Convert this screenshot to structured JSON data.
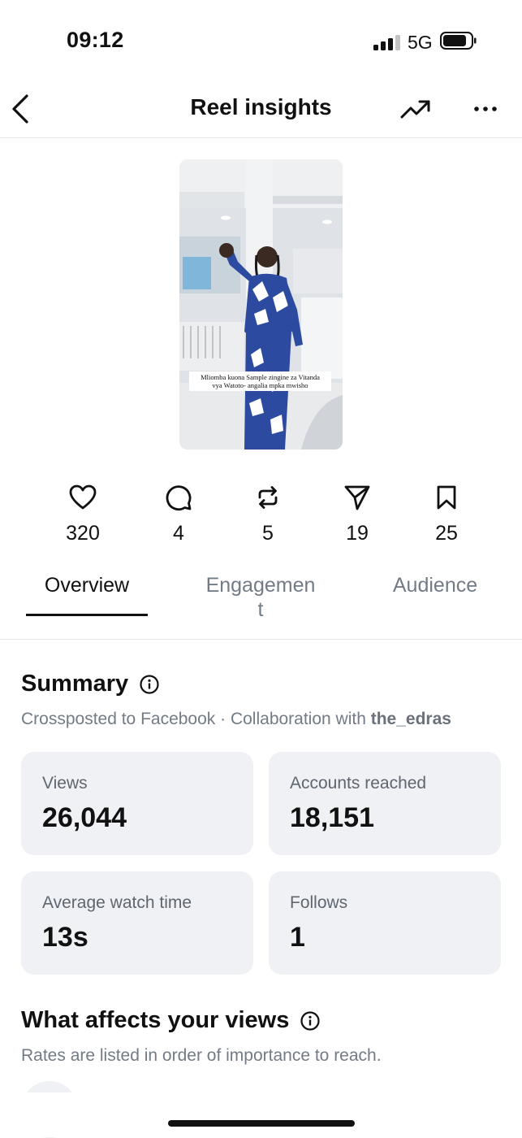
{
  "status_bar": {
    "time": "09:12",
    "network": "5G",
    "signal_bars": 3,
    "battery_level": 0.85
  },
  "header": {
    "title": "Reel insights",
    "back_icon": "chevron-left-icon",
    "trend_icon": "trending-up-icon",
    "more_icon": "more-horizontal-icon"
  },
  "reel": {
    "caption_line1": "Mliomba kuona Sample zingine za Vitanda",
    "caption_line2": "vya Watoto- angalia mpka mwisho"
  },
  "stats": [
    {
      "icon": "heart-icon",
      "value": "320"
    },
    {
      "icon": "comment-icon",
      "value": "4"
    },
    {
      "icon": "repost-icon",
      "value": "5"
    },
    {
      "icon": "share-icon",
      "value": "19"
    },
    {
      "icon": "bookmark-icon",
      "value": "25"
    }
  ],
  "tabs": [
    {
      "label": "Overview",
      "active": true
    },
    {
      "label_line1": "Engagemen",
      "label_line2": "t",
      "active": false
    },
    {
      "label": "Audience",
      "active": false
    }
  ],
  "summary": {
    "title": "Summary",
    "subtitle_prefix": "Crossposted to Facebook · Collaboration with ",
    "collaborator": "the_edras",
    "cards": [
      {
        "label": "Views",
        "value": "26,044"
      },
      {
        "label": "Accounts reached",
        "value": "18,151"
      },
      {
        "label": "Average watch time",
        "value": "13s"
      },
      {
        "label": "Follows",
        "value": "1"
      }
    ]
  },
  "views_section": {
    "title": "What affects your views",
    "subtitle": "Rates are listed in order of importance to reach."
  },
  "colors": {
    "text": "#111111",
    "muted": "#737b86",
    "card_bg": "#f0f1f4",
    "divider": "#e6e6e6"
  }
}
